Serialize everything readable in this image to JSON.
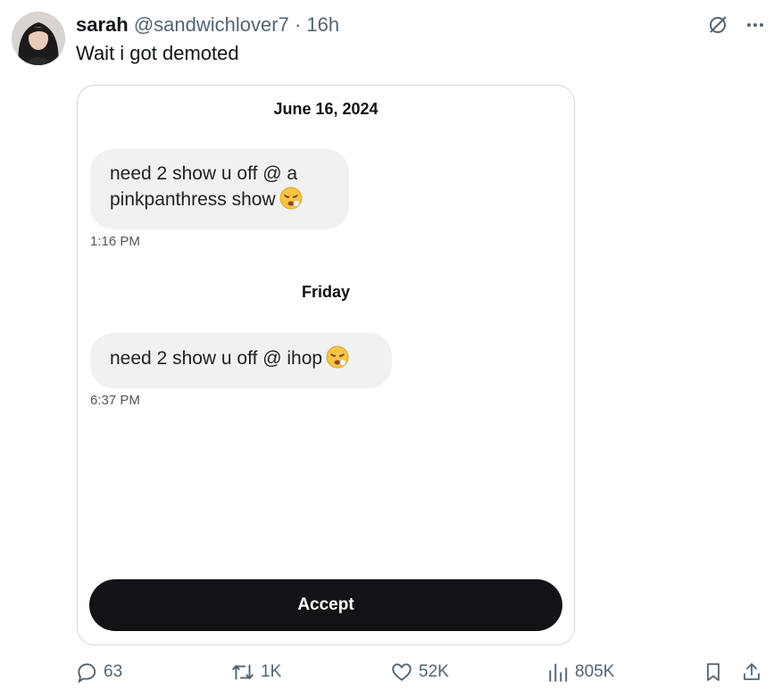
{
  "tweet": {
    "author_name": "sarah",
    "author_handle": "@sandwichlover7",
    "separator": "·",
    "time_ago": "16h",
    "text": "Wait i got demoted"
  },
  "screenshot": {
    "date_header_1": "June 16, 2024",
    "message_1_line_1": "need 2 show u off @ a",
    "message_1_line_2": "pinkpanthress show",
    "message_1_time": "1:16 PM",
    "date_header_2": "Friday",
    "message_2": "need 2 show u off @ ihop",
    "message_2_time": "6:37 PM",
    "accept_label": "Accept"
  },
  "actions": {
    "replies": "63",
    "reposts": "1K",
    "likes": "52K",
    "views": "805K"
  },
  "icons": {
    "grok": "grok-icon",
    "more": "more-icon",
    "reply": "reply-icon",
    "repost": "repost-icon",
    "like": "like-icon",
    "views": "views-icon",
    "bookmark": "bookmark-icon",
    "share": "share-icon",
    "emoji": "tired-face-emoji"
  },
  "colors": {
    "text_secondary": "#536471",
    "bubble_bg": "#eff1f2",
    "accept_bg": "#121316",
    "border": "#cfd9de"
  }
}
